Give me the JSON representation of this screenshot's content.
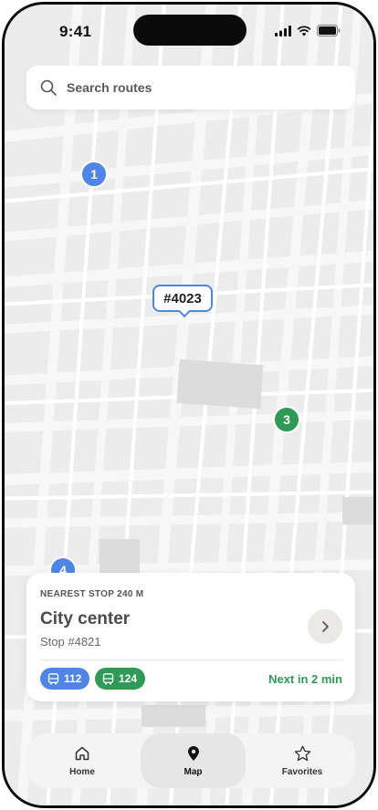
{
  "status_bar": {
    "time": "9:41"
  },
  "search": {
    "placeholder": "Search routes"
  },
  "map": {
    "pins": [
      {
        "label": "1",
        "color": "#4f86e6"
      },
      {
        "label": "3",
        "color": "#2f9a55"
      },
      {
        "label": "4",
        "color": "#4f86e6"
      }
    ],
    "vehicle_tag": "#4023"
  },
  "card": {
    "eyebrow": "NEAREST STOP 240 M",
    "title": "City center",
    "subtitle": "Stop #4821",
    "routes": [
      {
        "number": "112",
        "color": "#4f86e6"
      },
      {
        "number": "124",
        "color": "#2f9a55"
      }
    ],
    "next": "Next in 2 min"
  },
  "tabs": [
    {
      "label": "Home",
      "icon": "home-icon"
    },
    {
      "label": "Map",
      "icon": "map-pin-icon",
      "active": true
    },
    {
      "label": "Favorites",
      "icon": "star-icon"
    }
  ],
  "colors": {
    "accent_blue": "#4f86e6",
    "accent_green": "#2f9a55"
  }
}
